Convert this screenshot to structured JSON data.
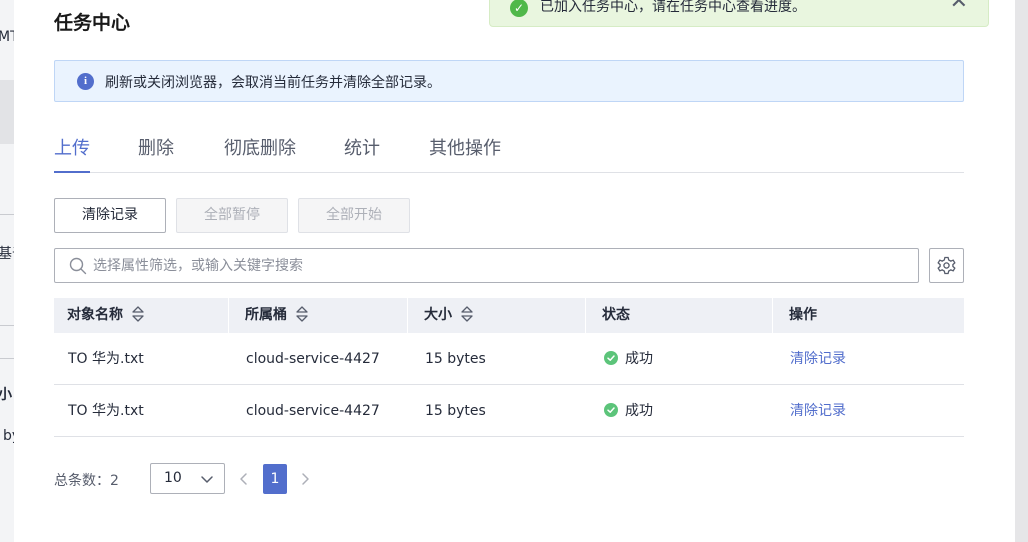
{
  "background": {
    "fragments": [
      "MT",
      "基于",
      "小",
      "by"
    ]
  },
  "title": "任务中心",
  "toast": {
    "message": "已加入任务中心，请在任务中心查看进度。",
    "close_glyph": "✕"
  },
  "alert": {
    "icon_glyph": "i",
    "message": "刷新或关闭浏览器，会取消当前任务并清除全部记录。"
  },
  "tabs": [
    {
      "label": "上传",
      "active": true
    },
    {
      "label": "删除",
      "active": false
    },
    {
      "label": "彻底删除",
      "active": false
    },
    {
      "label": "统计",
      "active": false
    },
    {
      "label": "其他操作",
      "active": false
    }
  ],
  "toolbar": {
    "clear_label": "清除记录",
    "pause_all_label": "全部暂停",
    "start_all_label": "全部开始"
  },
  "search": {
    "placeholder": "选择属性筛选，或输入关键字搜索",
    "value": ""
  },
  "table": {
    "headers": [
      "对象名称",
      "所属桶",
      "大小",
      "状态",
      "操作"
    ],
    "rows": [
      {
        "name": "TO 华为.txt",
        "bucket": "cloud-service-4427",
        "size": "15 bytes",
        "status": "成功",
        "action": "清除记录"
      },
      {
        "name": "TO 华为.txt",
        "bucket": "cloud-service-4427",
        "size": "15 bytes",
        "status": "成功",
        "action": "清除记录"
      }
    ]
  },
  "pagination": {
    "total_label": "总条数：2",
    "page_size": "10",
    "current_page": "1"
  },
  "colors": {
    "accent": "#526ecc",
    "success": "#5cc47a",
    "toast_bg": "#e9f6df",
    "alert_bg": "#eaf3fe"
  }
}
